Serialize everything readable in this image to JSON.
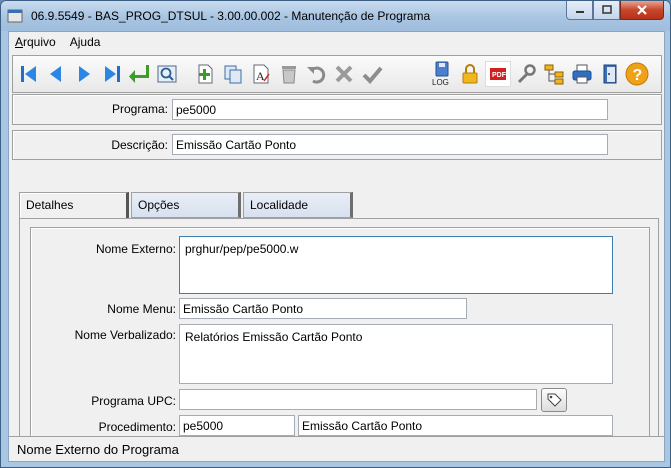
{
  "window": {
    "title": "06.9.5549 - BAS_PROG_DTSUL - 3.00.00.002 - Manutenção de Programa",
    "minimize_icon": "minimize-icon",
    "maximize_icon": "maximize-icon",
    "close_icon": "close-icon"
  },
  "menu": {
    "items": [
      {
        "label": "Arquivo",
        "mnemonic": "A"
      },
      {
        "label": "Ajuda",
        "mnemonic": "j"
      }
    ]
  },
  "toolbar": {
    "buttons": [
      "first-record-icon",
      "previous-record-icon",
      "next-record-icon",
      "last-record-icon",
      "goto-icon",
      "search-icon",
      "add-icon",
      "copy-icon",
      "edit-icon",
      "delete-icon",
      "undo-icon",
      "cancel-icon",
      "confirm-icon",
      "log-icon",
      "lock-icon",
      "pdf-icon",
      "tools-icon",
      "tree-icon",
      "print-icon",
      "exit-icon",
      "help-icon"
    ],
    "log_label": "LOG",
    "pdf_label": "PDF"
  },
  "header": {
    "programa_label": "Programa:",
    "programa_value": "pe5000",
    "descricao_label": "Descrição:",
    "descricao_value": "Emissão Cartão Ponto"
  },
  "tabs": [
    {
      "label": "Detalhes",
      "active": true
    },
    {
      "label": "Opções",
      "active": false
    },
    {
      "label": "Localidade",
      "active": false
    }
  ],
  "details": {
    "nome_externo_label": "Nome Externo:",
    "nome_externo_value": "prghur/pep/pe5000.w",
    "nome_menu_label": "Nome Menu:",
    "nome_menu_value": "Emissão Cartão Ponto",
    "nome_verbalizado_label": "Nome Verbalizado:",
    "nome_verbalizado_value": "Relatórios Emissão Cartão Ponto",
    "programa_upc_label": "Programa UPC:",
    "programa_upc_value": "",
    "procedimento_label": "Procedimento:",
    "procedimento_code": "pe5000",
    "procedimento_desc": "Emissão Cartão Ponto"
  },
  "status_bar": {
    "text": "Nome Externo do Programa"
  }
}
